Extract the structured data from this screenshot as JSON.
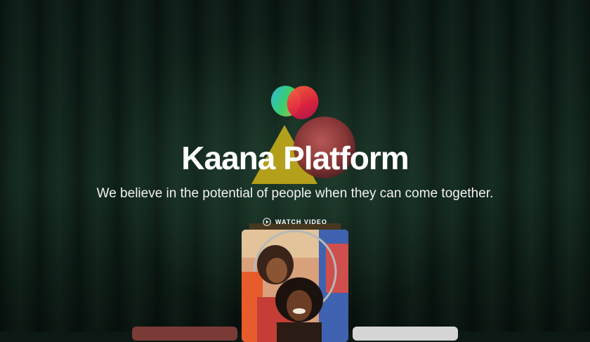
{
  "hero": {
    "title": "Kaana Platform",
    "tagline": "We believe in the potential of people when they can come together.",
    "watch_video_label": "WATCH VIDEO"
  },
  "icons": {
    "logo": "heart-logo-icon",
    "play": "play-circle-icon"
  },
  "colors": {
    "background": "#0c1813",
    "text": "#ffffff"
  }
}
